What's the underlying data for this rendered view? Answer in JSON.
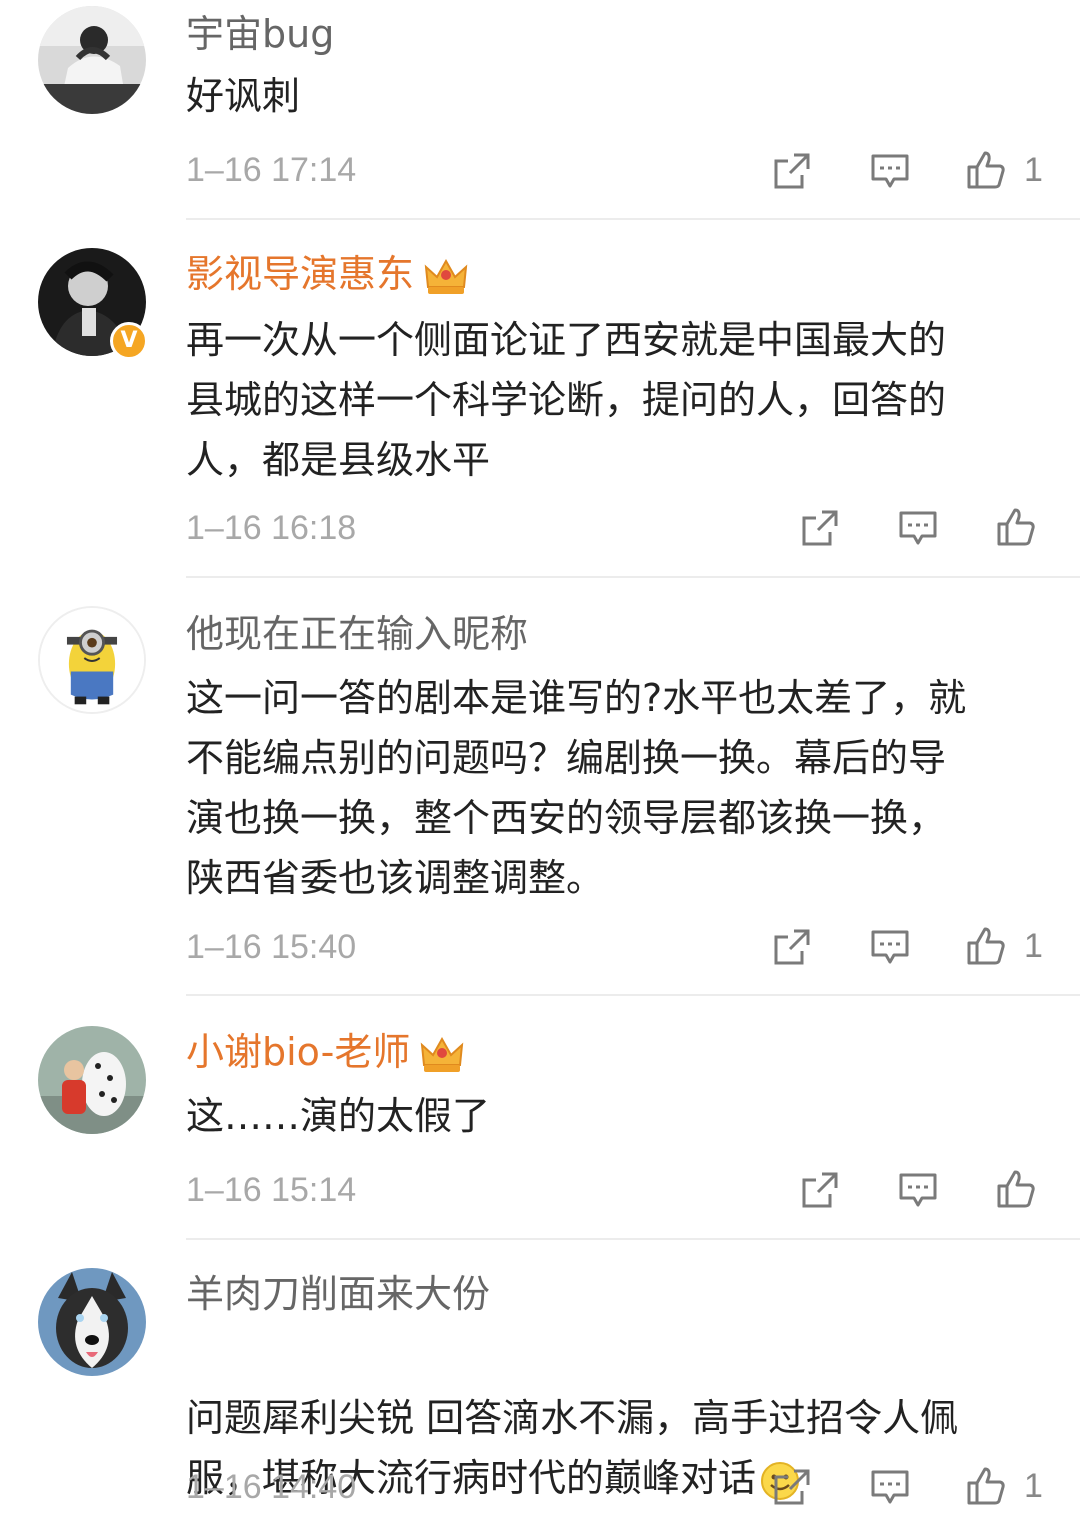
{
  "comments": [
    {
      "name": "宇宙bug",
      "text": "好讽刺",
      "time": "1–16 17:14",
      "likes": "1",
      "avatar_icon": "person-resting-photo"
    },
    {
      "name": "影视导演惠东",
      "text": "再一次从一个侧面论证了西安就是中国最大的\n县城的这样一个科学论断，提问的人，回答的\n人，都是县级水平",
      "time": "1–16 16:18",
      "likes": "",
      "avatar_icon": "man-in-dark-photo",
      "verified_icon": "v-badge-icon",
      "vip_icon": "crown-icon"
    },
    {
      "name": "他现在正在输入昵称",
      "text": "这一问一答的剧本是谁写的?水平也太差了，就\n不能编点别的问题吗？编剧换一换。幕后的导\n演也换一换，整个西安的领导层都该换一换，\n陕西省委也该调整调整。",
      "time": "1–16 15:40",
      "likes": "1",
      "avatar_icon": "minion-cartoon"
    },
    {
      "name": "小谢bio-老师",
      "text": "这……演的太假了",
      "time": "1–16 15:14",
      "likes": "",
      "avatar_icon": "child-with-dog-photo",
      "vip_icon": "crown-icon"
    },
    {
      "name": "羊肉刀削面来大份",
      "text": "问题犀利尖锐 回答滴水不漏，高手过招令人佩\n服，堪称大流行病时代的巅峰对话",
      "time": "1–16 14:40",
      "likes": "1",
      "avatar_icon": "husky-dog-photo",
      "emoji": "smile-emoji"
    }
  ],
  "colors": {
    "name_normal": "#666666",
    "name_vip": "#e5762c",
    "text": "#222222",
    "time": "#a8a8a8",
    "icon": "#7a7a7a"
  }
}
